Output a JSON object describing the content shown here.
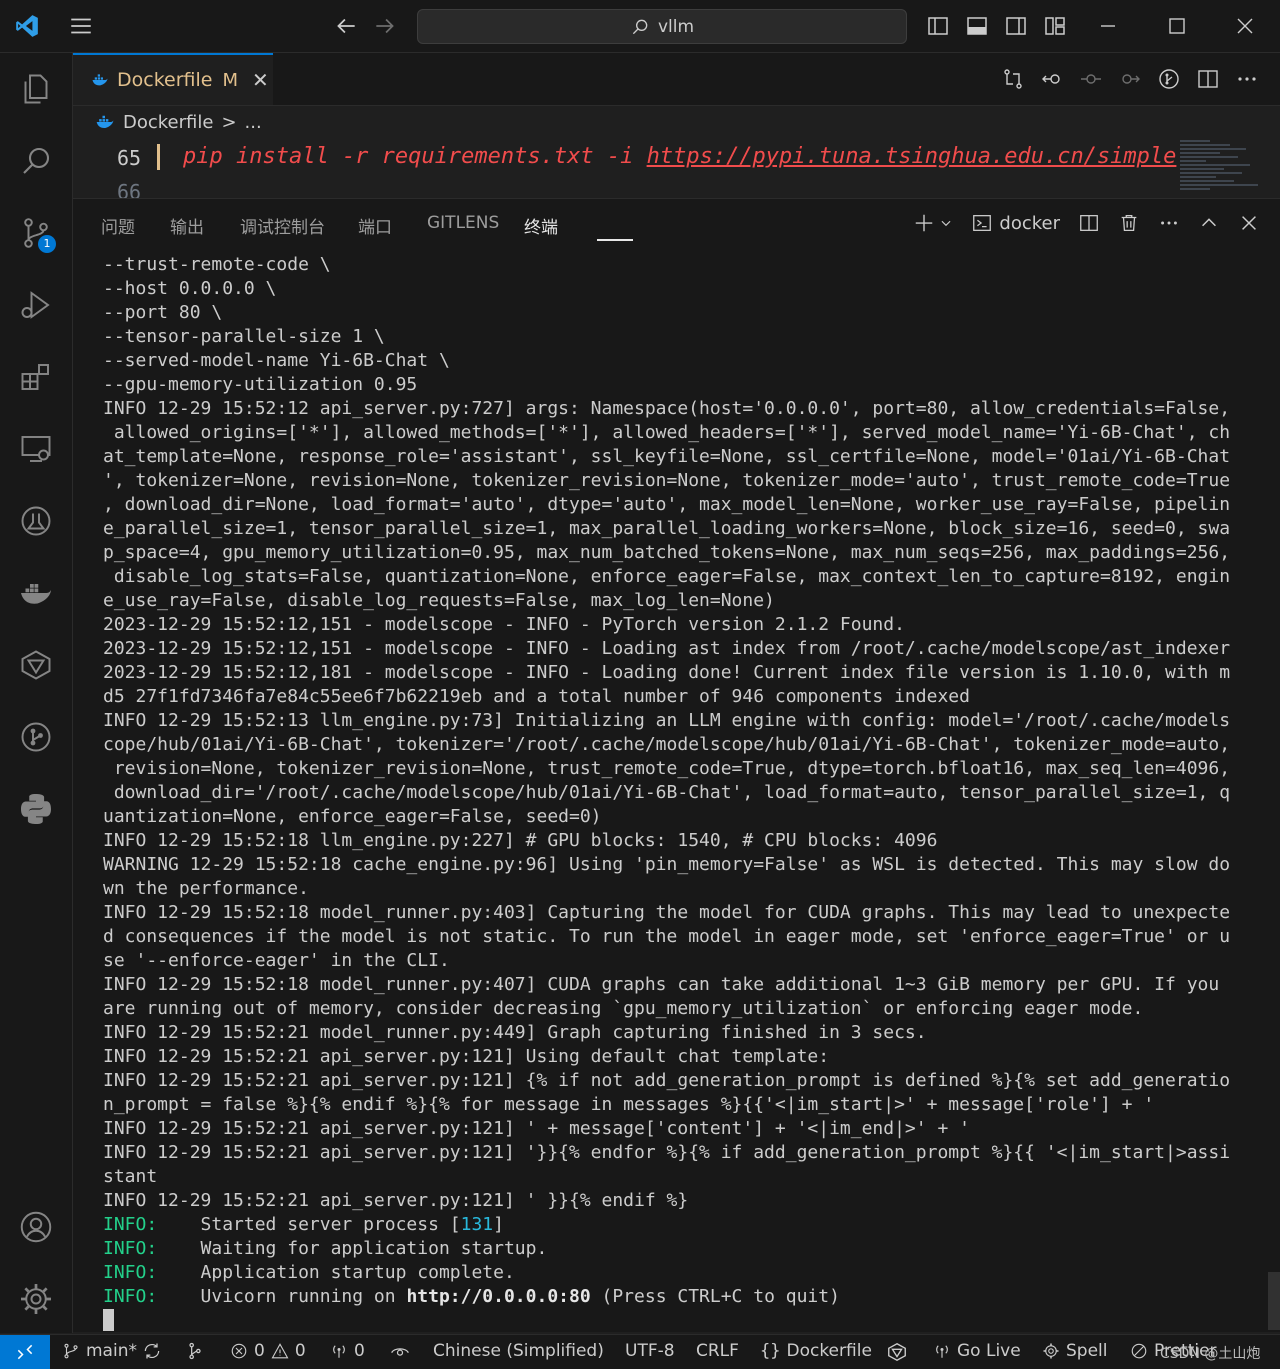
{
  "titlebar": {
    "search_text": "vllm",
    "icons": [
      "vscode-logo-icon",
      "menu-icon",
      "back-arrow-icon",
      "forward-arrow-icon",
      "toggle-primary-sidebar-icon",
      "toggle-panel-icon",
      "toggle-secondary-sidebar-icon",
      "customize-layout-icon",
      "minimize-icon",
      "maximize-icon",
      "close-icon"
    ]
  },
  "activitybar": {
    "items": [
      "explorer-icon",
      "search-icon",
      "source-control-icon",
      "run-debug-icon",
      "extensions-icon",
      "remote-explorer-icon",
      "testing-icon",
      "docker-icon",
      "gitlens-icon",
      "git-graph-icon",
      "python-icon",
      "accounts-icon",
      "manage-gear-icon"
    ],
    "scm_badge": "1"
  },
  "tab": {
    "title": "Dockerfile",
    "modified": "M",
    "close": "✕"
  },
  "breadcrumb": {
    "file": "Dockerfile",
    "sep": ">",
    "rest": "..."
  },
  "editor": {
    "line_number": "65",
    "line_number_next": "66",
    "code_prefix": "pip install -r requirements.txt -i ",
    "code_url": "https://pypi.tuna.tsinghua.edu.cn/simple"
  },
  "panel": {
    "tabs": [
      "问题",
      "输出",
      "调试控制台",
      "端口",
      "GITLENS",
      "终端"
    ],
    "active_tab": "终端",
    "terminal_name": "docker"
  },
  "terminal": {
    "lines": [
      "--trust-remote-code \\",
      "--host 0.0.0.0 \\",
      "--port 80 \\",
      "--tensor-parallel-size 1 \\",
      "--served-model-name Yi-6B-Chat \\",
      "--gpu-memory-utilization 0.95",
      "INFO 12-29 15:52:12 api_server.py:727] args: Namespace(host='0.0.0.0', port=80, allow_credentials=False,",
      " allowed_origins=['*'], allowed_methods=['*'], allowed_headers=['*'], served_model_name='Yi-6B-Chat', ch",
      "at_template=None, response_role='assistant', ssl_keyfile=None, ssl_certfile=None, model='01ai/Yi-6B-Chat",
      "', tokenizer=None, revision=None, tokenizer_revision=None, tokenizer_mode='auto', trust_remote_code=True",
      ", download_dir=None, load_format='auto', dtype='auto', max_model_len=None, worker_use_ray=False, pipelin",
      "e_parallel_size=1, tensor_parallel_size=1, max_parallel_loading_workers=None, block_size=16, seed=0, swa",
      "p_space=4, gpu_memory_utilization=0.95, max_num_batched_tokens=None, max_num_seqs=256, max_paddings=256,",
      " disable_log_stats=False, quantization=None, enforce_eager=False, max_context_len_to_capture=8192, engin",
      "e_use_ray=False, disable_log_requests=False, max_log_len=None)",
      "2023-12-29 15:52:12,151 - modelscope - INFO - PyTorch version 2.1.2 Found.",
      "2023-12-29 15:52:12,151 - modelscope - INFO - Loading ast index from /root/.cache/modelscope/ast_indexer",
      "2023-12-29 15:52:12,181 - modelscope - INFO - Loading done! Current index file version is 1.10.0, with m",
      "d5 27f1fd7346fa7e84c55ee6f7b62219eb and a total number of 946 components indexed",
      "INFO 12-29 15:52:13 llm_engine.py:73] Initializing an LLM engine with config: model='/root/.cache/models",
      "cope/hub/01ai/Yi-6B-Chat', tokenizer='/root/.cache/modelscope/hub/01ai/Yi-6B-Chat', tokenizer_mode=auto,",
      " revision=None, tokenizer_revision=None, trust_remote_code=True, dtype=torch.bfloat16, max_seq_len=4096,",
      " download_dir='/root/.cache/modelscope/hub/01ai/Yi-6B-Chat', load_format=auto, tensor_parallel_size=1, q",
      "uantization=None, enforce_eager=False, seed=0)",
      "INFO 12-29 15:52:18 llm_engine.py:227] # GPU blocks: 1540, # CPU blocks: 4096",
      "WARNING 12-29 15:52:18 cache_engine.py:96] Using 'pin_memory=False' as WSL is detected. This may slow do",
      "wn the performance.",
      "INFO 12-29 15:52:18 model_runner.py:403] Capturing the model for CUDA graphs. This may lead to unexpecte",
      "d consequences if the model is not static. To run the model in eager mode, set 'enforce_eager=True' or u",
      "se '--enforce-eager' in the CLI.",
      "INFO 12-29 15:52:18 model_runner.py:407] CUDA graphs can take additional 1~3 GiB memory per GPU. If you",
      "are running out of memory, consider decreasing `gpu_memory_utilization` or enforcing eager mode.",
      "INFO 12-29 15:52:21 model_runner.py:449] Graph capturing finished in 3 secs.",
      "INFO 12-29 15:52:21 api_server.py:121] Using default chat template:",
      "INFO 12-29 15:52:21 api_server.py:121] {% if not add_generation_prompt is defined %}{% set add_generatio",
      "n_prompt = false %}{% endif %}{% for message in messages %}{{'<|im_start|>' + message['role'] + '",
      "INFO 12-29 15:52:21 api_server.py:121] ' + message['content'] + '<|im_end|>' + '",
      "INFO 12-29 15:52:21 api_server.py:121] '}}{% endfor %}{% if add_generation_prompt %}{{ '<|im_start|>assi",
      "stant",
      "INFO 12-29 15:52:21 api_server.py:121] ' }}{% endif %}"
    ],
    "info_prefix": "INFO:",
    "uvicorn": [
      {
        "pre": "    Started server process [",
        "pid": "131",
        "post": "]"
      },
      {
        "pre": "    Waiting for application startup.",
        "pid": "",
        "post": ""
      },
      {
        "pre": "    Application startup complete.",
        "pid": "",
        "post": ""
      }
    ],
    "running_pre": "    Uvicorn running on ",
    "running_url": "http://0.0.0.0:80",
    "running_post": " (Press CTRL+C to quit)"
  },
  "statusbar": {
    "branch": "main*",
    "errors": "0",
    "warnings": "0",
    "ports": "0",
    "language_locale": "Chinese (Simplified)",
    "encoding": "UTF-8",
    "eol": "CRLF",
    "language_mode": "Dockerfile",
    "go_live": "Go Live",
    "spell": "Spell",
    "prettier": "Prettier",
    "watermark": "CSDN @土山炮"
  },
  "colors": {
    "accent": "#0078d4",
    "modified": "#e2c08d",
    "code": "#f14c4c",
    "info_green": "#23d18b",
    "pid_cyan": "#29b8db"
  }
}
